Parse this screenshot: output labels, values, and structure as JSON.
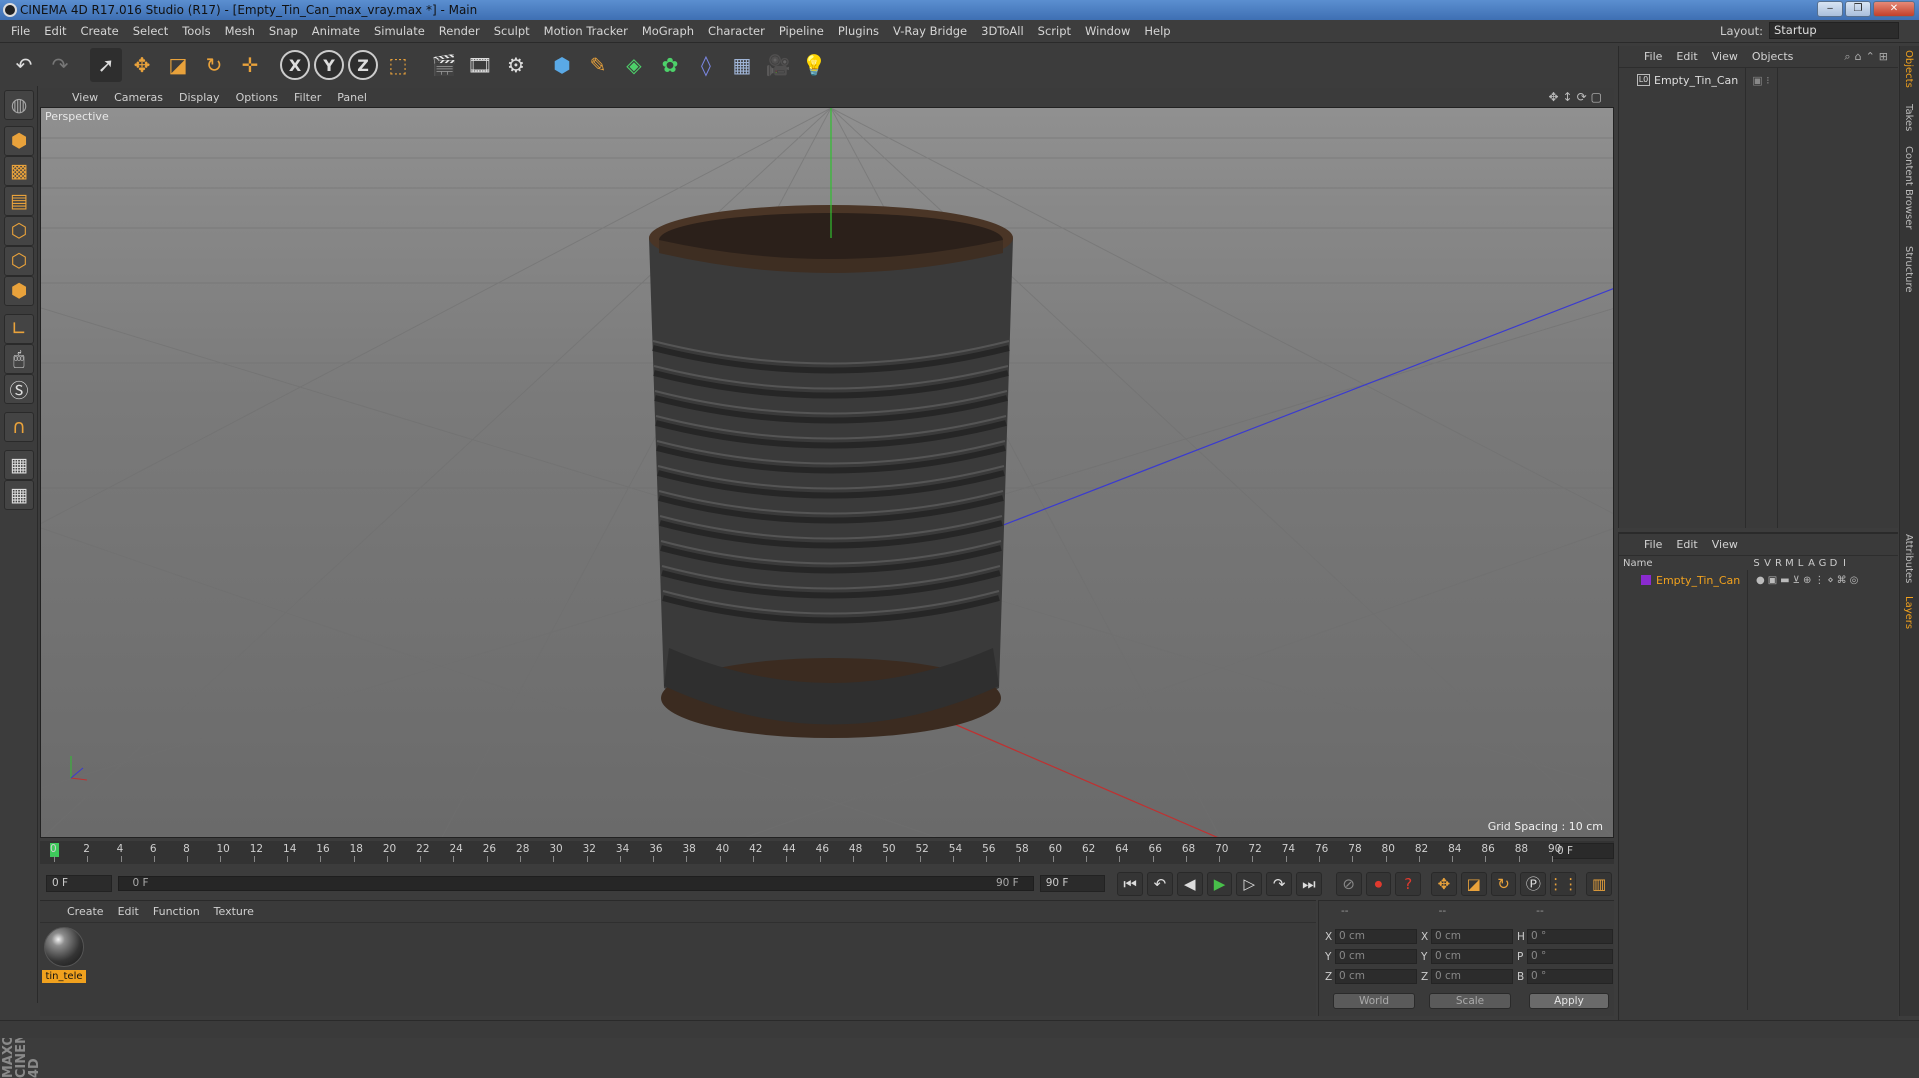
{
  "window": {
    "title": "CINEMA 4D R17.016 Studio (R17) - [Empty_Tin_Can_max_vray.max *] - Main",
    "minimize": "‒",
    "maximize": "❐",
    "close": "✕"
  },
  "menubar": {
    "items": [
      "File",
      "Edit",
      "Create",
      "Select",
      "Tools",
      "Mesh",
      "Snap",
      "Animate",
      "Simulate",
      "Render",
      "Sculpt",
      "Motion Tracker",
      "MoGraph",
      "Character",
      "Pipeline",
      "Plugins",
      "V-Ray Bridge",
      "3DToAll",
      "Script",
      "Window",
      "Help"
    ],
    "layout_label": "Layout:",
    "layout_value": "Startup"
  },
  "viewport": {
    "menu": [
      "View",
      "Cameras",
      "Display",
      "Options",
      "Filter",
      "Panel"
    ],
    "label": "Perspective",
    "grid_spacing": "Grid Spacing : 10 cm"
  },
  "timeline": {
    "ticks": [
      "0",
      "2",
      "4",
      "6",
      "8",
      "10",
      "12",
      "14",
      "16",
      "18",
      "20",
      "22",
      "24",
      "26",
      "28",
      "30",
      "32",
      "34",
      "36",
      "38",
      "40",
      "42",
      "44",
      "46",
      "48",
      "50",
      "52",
      "54",
      "56",
      "58",
      "60",
      "62",
      "64",
      "66",
      "68",
      "70",
      "72",
      "74",
      "76",
      "78",
      "80",
      "82",
      "84",
      "86",
      "88",
      "90"
    ],
    "current_frame": "0 F",
    "start_frame": "0 F",
    "range_start": "0 F",
    "range_end": "90 F",
    "end_frame": "90 F"
  },
  "material_manager": {
    "menu": [
      "Create",
      "Edit",
      "Function",
      "Texture"
    ],
    "material_name": "tin_tele"
  },
  "coordinates": {
    "headers": [
      "--",
      "--",
      "--"
    ],
    "rows": [
      {
        "a": "X",
        "v1": "0 cm",
        "b": "X",
        "v2": "0 cm",
        "c": "H",
        "v3": "0 °"
      },
      {
        "a": "Y",
        "v1": "0 cm",
        "b": "Y",
        "v2": "0 cm",
        "c": "P",
        "v3": "0 °"
      },
      {
        "a": "Z",
        "v1": "0 cm",
        "b": "Z",
        "v2": "0 cm",
        "c": "B",
        "v3": "0 °"
      }
    ],
    "space": "World",
    "mode": "Scale",
    "apply": "Apply"
  },
  "object_manager": {
    "menu": [
      "File",
      "Edit",
      "View",
      "Objects"
    ],
    "object_name": "Empty_Tin_Can"
  },
  "layer_manager": {
    "menu": [
      "File",
      "Edit",
      "View"
    ],
    "columns": [
      "Name",
      "S",
      "V",
      "R",
      "M",
      "L",
      "A",
      "G",
      "D",
      "I"
    ],
    "layer_name": "Empty_Tin_Can",
    "layer_color": "#8b2bd0"
  },
  "side_tabs": [
    "Objects",
    "Takes",
    "Content Browser",
    "Structure",
    "Attributes",
    "Layers"
  ],
  "brand": "MAXON CINEMA 4D",
  "colors": {
    "accent": "#e9a23b",
    "selection": "#f0a11e",
    "title_bar": "#4a7fc1"
  }
}
